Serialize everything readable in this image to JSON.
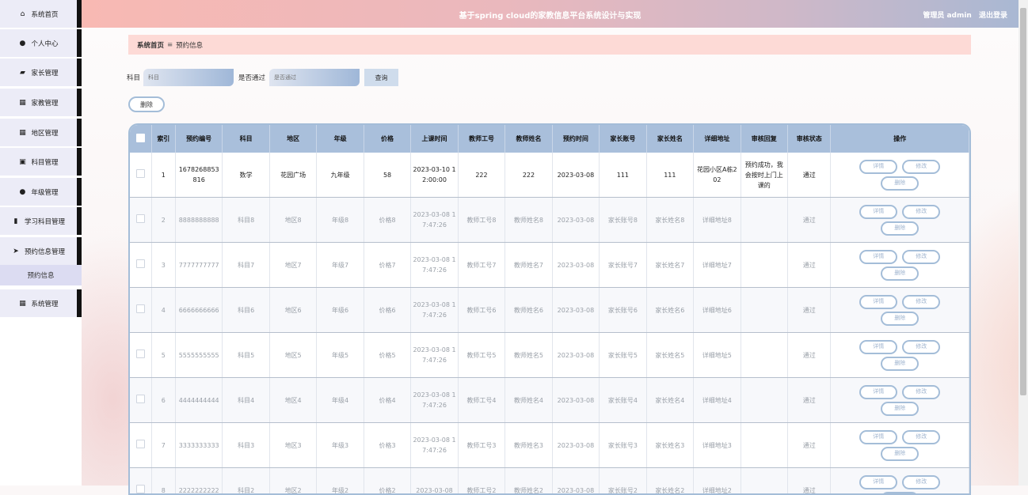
{
  "header": {
    "title": "基于spring cloud的家教信息平台系统设计与实现",
    "user": "管理员 admin",
    "logout": "退出登录"
  },
  "sidebar": {
    "items": [
      {
        "label": "系统首页",
        "icon": "home-icon",
        "glyph": "⌂"
      },
      {
        "label": "个人中心",
        "icon": "user-icon",
        "glyph": "●"
      },
      {
        "label": "家长管理",
        "icon": "folder-icon",
        "glyph": "▰"
      },
      {
        "label": "家教管理",
        "icon": "grid-icon",
        "glyph": "▦"
      },
      {
        "label": "地区管理",
        "icon": "grid-icon",
        "glyph": "▦"
      },
      {
        "label": "科目管理",
        "icon": "briefcase-icon",
        "glyph": "▣"
      },
      {
        "label": "年级管理",
        "icon": "user-icon",
        "glyph": "●"
      },
      {
        "label": "学习科目管理",
        "icon": "bar-chart-icon",
        "glyph": "▮"
      },
      {
        "label": "预约信息管理",
        "icon": "send-icon",
        "glyph": "➤"
      },
      {
        "label": "系统管理",
        "icon": "grid-icon",
        "glyph": "▦"
      }
    ],
    "submenu": "预约信息"
  },
  "breadcrumb": {
    "home": "系统首页",
    "separator": "≡",
    "current": "预约信息"
  },
  "search": {
    "label1": "科目",
    "placeholder1": "科目",
    "label2": "是否通过",
    "placeholder2": "是否通过",
    "query_label": "查询"
  },
  "delete_all_label": "删除",
  "table": {
    "headers": [
      "索引",
      "预约编号",
      "科目",
      "地区",
      "年级",
      "价格",
      "上课时间",
      "教师工号",
      "教师姓名",
      "预约时间",
      "家长账号",
      "家长姓名",
      "详细地址",
      "审核回复",
      "审核状态",
      "操作"
    ],
    "rows": [
      [
        "1",
        "1678268853816",
        "数学",
        "花园广场",
        "九年级",
        "58",
        "2023-03-10 12:00:00",
        "222",
        "222",
        "2023-03-08",
        "111",
        "111",
        "花园小区A栋202",
        "预约成功，我会按时上门上课的",
        "通过"
      ],
      [
        "2",
        "8888888888",
        "科目8",
        "地区8",
        "年级8",
        "价格8",
        "2023-03-08 17:47:26",
        "教师工号8",
        "教师姓名8",
        "2023-03-08",
        "家长账号8",
        "家长姓名8",
        "详细地址8",
        "",
        "通过"
      ],
      [
        "3",
        "7777777777",
        "科目7",
        "地区7",
        "年级7",
        "价格7",
        "2023-03-08 17:47:26",
        "教师工号7",
        "教师姓名7",
        "2023-03-08",
        "家长账号7",
        "家长姓名7",
        "详细地址7",
        "",
        "通过"
      ],
      [
        "4",
        "6666666666",
        "科目6",
        "地区6",
        "年级6",
        "价格6",
        "2023-03-08 17:47:26",
        "教师工号6",
        "教师姓名6",
        "2023-03-08",
        "家长账号6",
        "家长姓名6",
        "详细地址6",
        "",
        "通过"
      ],
      [
        "5",
        "5555555555",
        "科目5",
        "地区5",
        "年级5",
        "价格5",
        "2023-03-08 17:47:26",
        "教师工号5",
        "教师姓名5",
        "2023-03-08",
        "家长账号5",
        "家长姓名5",
        "详细地址5",
        "",
        "通过"
      ],
      [
        "6",
        "4444444444",
        "科目4",
        "地区4",
        "年级4",
        "价格4",
        "2023-03-08 17:47:26",
        "教师工号4",
        "教师姓名4",
        "2023-03-08",
        "家长账号4",
        "家长姓名4",
        "详细地址4",
        "",
        "通过"
      ],
      [
        "7",
        "3333333333",
        "科目3",
        "地区3",
        "年级3",
        "价格3",
        "2023-03-08 17:47:26",
        "教师工号3",
        "教师姓名3",
        "2023-03-08",
        "家长账号3",
        "家长姓名3",
        "详细地址3",
        "",
        "通过"
      ],
      [
        "8",
        "2222222222",
        "科目2",
        "地区2",
        "年级2",
        "价格2",
        "2023-03-08",
        "教师工号2",
        "教师姓名2",
        "2023-03-08",
        "家长账号2",
        "家长姓名2",
        "详细地址2",
        "",
        "通过"
      ]
    ],
    "ops": [
      "详情",
      "修改",
      "删除"
    ]
  }
}
